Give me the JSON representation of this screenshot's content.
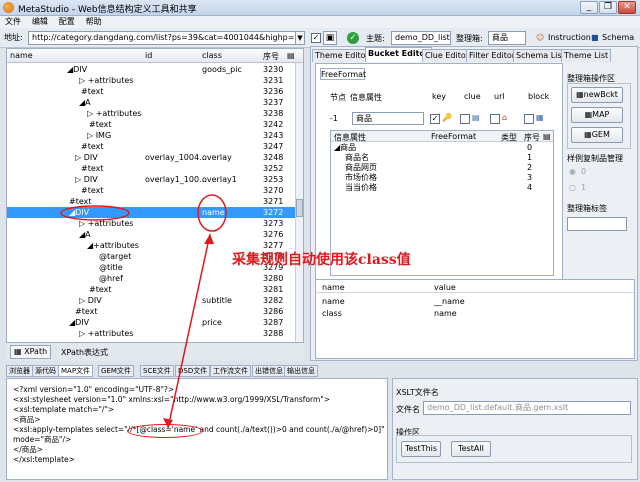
{
  "window": {
    "title": "MetaStudio - Web信息结构定义工具和共享",
    "minimize": "_",
    "restore": "❐",
    "close": "✕"
  },
  "menu": [
    "文件",
    "编辑",
    "配置",
    "帮助"
  ],
  "address": {
    "label": "地址:",
    "value": "http://category.dangdang.com/list?ps=39&cat=4001044&highp=&lowp"
  },
  "toolbar": {
    "theme_label": "主题:",
    "theme_value": "demo_DD_list",
    "organize_label": "整理箱:",
    "organize_value": "商品",
    "instruction": "Instruction",
    "schema": "Schema"
  },
  "tree": {
    "headers": [
      "name",
      "id",
      "class",
      "序号"
    ],
    "rows": [
      {
        "name": "◢DIV",
        "id": "",
        "class": "goods_pic",
        "seq": "3230",
        "indent": 60
      },
      {
        "name": "▷ +attributes",
        "id": "",
        "class": "",
        "seq": "3231",
        "indent": 72
      },
      {
        "name": "#text",
        "id": "",
        "class": "",
        "seq": "3236",
        "indent": 74
      },
      {
        "name": "◢A",
        "id": "",
        "class": "",
        "seq": "3237",
        "indent": 72
      },
      {
        "name": "▷ +attributes",
        "id": "",
        "class": "",
        "seq": "3238",
        "indent": 80
      },
      {
        "name": "#text",
        "id": "",
        "class": "",
        "seq": "3242",
        "indent": 82
      },
      {
        "name": "▷ IMG",
        "id": "",
        "class": "",
        "seq": "3243",
        "indent": 80
      },
      {
        "name": "#text",
        "id": "",
        "class": "",
        "seq": "3247",
        "indent": 74
      },
      {
        "name": "▷ DIV",
        "id": "overlay_1004...",
        "class": "overlay",
        "seq": "3248",
        "indent": 68
      },
      {
        "name": "#text",
        "id": "",
        "class": "",
        "seq": "3252",
        "indent": 74
      },
      {
        "name": "▷ DIV",
        "id": "overlay1_100...",
        "class": "overlay1",
        "seq": "3253",
        "indent": 68
      },
      {
        "name": "#text",
        "id": "",
        "class": "",
        "seq": "3270",
        "indent": 74
      },
      {
        "name": "#text",
        "id": "",
        "class": "",
        "seq": "3271",
        "indent": 62
      },
      {
        "name": "◢DIV",
        "id": "",
        "class": "name",
        "seq": "3272",
        "indent": 62,
        "selected": true
      },
      {
        "name": "▷ +attributes",
        "id": "",
        "class": "",
        "seq": "3273",
        "indent": 72
      },
      {
        "name": "◢A",
        "id": "",
        "class": "",
        "seq": "3276",
        "indent": 72
      },
      {
        "name": "◢+attributes",
        "id": "",
        "class": "",
        "seq": "3277",
        "indent": 80
      },
      {
        "name": "@target",
        "id": "",
        "class": "",
        "seq": "3278",
        "indent": 92
      },
      {
        "name": "@title",
        "id": "",
        "class": "",
        "seq": "3279",
        "indent": 92
      },
      {
        "name": "@href",
        "id": "",
        "class": "",
        "seq": "3280",
        "indent": 92
      },
      {
        "name": "#text",
        "id": "",
        "class": "",
        "seq": "3281",
        "indent": 82
      },
      {
        "name": "▷ DIV",
        "id": "",
        "class": "subtitle",
        "seq": "3282",
        "indent": 72
      },
      {
        "name": "#text",
        "id": "",
        "class": "",
        "seq": "3286",
        "indent": 68
      },
      {
        "name": "◢DIV",
        "id": "",
        "class": "price",
        "seq": "3287",
        "indent": 62
      },
      {
        "name": "▷ +attributes",
        "id": "",
        "class": "",
        "seq": "3288",
        "indent": 72
      }
    ]
  },
  "xpath_bar": {
    "button": "XPath",
    "label": "XPath表达式"
  },
  "right_tabs": [
    "Theme Editor",
    "Bucket Editor",
    "Clue Editor",
    "Filter Editor",
    "Schema List",
    "Theme List"
  ],
  "bucket": {
    "format_tab": "FreeFormat",
    "col_headers": [
      "节点",
      "信息属性",
      "key",
      "clue",
      "url",
      "block"
    ],
    "node_value": "-1",
    "attr_value": "商品",
    "table_headers": [
      "信息属性",
      "FreeFormat",
      "类型",
      "序号"
    ],
    "table_rows": [
      {
        "name": "◢商品",
        "type": "",
        "seq": "0"
      },
      {
        "name": "商品名",
        "type": "",
        "seq": "1"
      },
      {
        "name": "商品网页",
        "type": "",
        "seq": "2"
      },
      {
        "name": "市场价格",
        "type": "",
        "seq": "3"
      },
      {
        "name": "当当价格",
        "type": "",
        "seq": "4"
      }
    ]
  },
  "manager": {
    "title": "整理箱操作区",
    "new_button": "newBckt",
    "map_button": "MAP",
    "gem_button": "GEM",
    "copy_title": "样例复制品管理",
    "radio0": "0",
    "radio1": "1",
    "tag_title": "整理箱标签"
  },
  "properties": {
    "headers": [
      "name",
      "value"
    ],
    "rows": [
      {
        "name": "name",
        "value": "__name"
      },
      {
        "name": "class",
        "value": "name"
      }
    ]
  },
  "bottom_tabs": [
    "浏览器",
    "源代码",
    "MAP文件",
    "GEM文件",
    "SCE文件",
    "DSD文件",
    "工作流文件",
    "出错信息",
    "输出信息"
  ],
  "code_lines": [
    "<?xml version=\"1.0\" encoding=\"UTF-8\"?>",
    "<xsl:stylesheet version=\"1.0\" xmlns:xsl=\"http://www.w3.org/1999/XSL/Transform\">",
    "<xsl:template match=\"/\">",
    "<商品>",
    "<xsl:apply-templates select=\"//*[@class='name' and count(./a/text())>0 and count(./a/@href)>0]\"",
    "mode=\"商品\"/>",
    "</商品>",
    "</xsl:template>"
  ],
  "xslt": {
    "title": "XSLT文件名",
    "file_label": "文件名",
    "file_value": "demo_DD_list.default.商品.gem.xslt",
    "ops_title": "操作区",
    "test_this": "TestThis",
    "test_all": "TestAll"
  },
  "annotation": "采集规则自动使用该class值",
  "colors": {
    "annotation": "#e0191d",
    "selection": "#3399ff"
  }
}
